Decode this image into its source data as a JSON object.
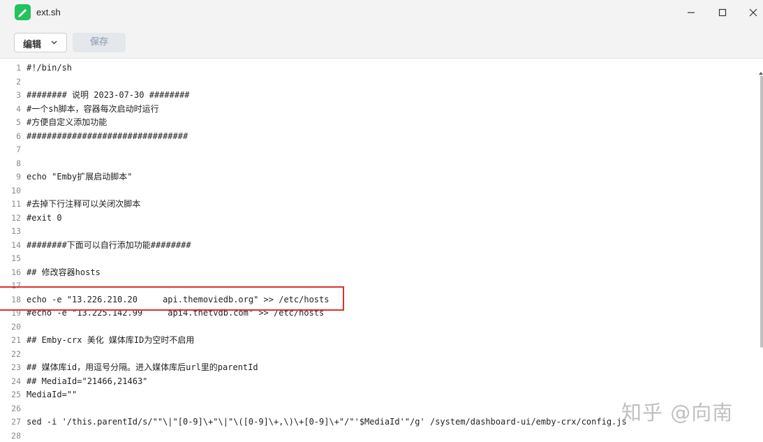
{
  "window": {
    "title": "ext.sh",
    "accent": "#22c35d"
  },
  "toolbar": {
    "edit_label": "编辑",
    "save_label": "保存"
  },
  "editor": {
    "lines": [
      {
        "n": "1",
        "text": "#!/bin/sh"
      },
      {
        "n": "2",
        "text": ""
      },
      {
        "n": "3",
        "text": "######## 说明 2023-07-30 ########"
      },
      {
        "n": "4",
        "text": "#一个sh脚本，容器每次启动时运行"
      },
      {
        "n": "5",
        "text": "#方便自定义添加功能"
      },
      {
        "n": "6",
        "text": "################################"
      },
      {
        "n": "7",
        "text": ""
      },
      {
        "n": "8",
        "text": ""
      },
      {
        "n": "9",
        "text": "echo \"Emby扩展启动脚本\""
      },
      {
        "n": "10",
        "text": ""
      },
      {
        "n": "11",
        "text": "#去掉下行注释可以关闭次脚本"
      },
      {
        "n": "12",
        "text": "#exit 0"
      },
      {
        "n": "13",
        "text": ""
      },
      {
        "n": "14",
        "text": "########下面可以自行添加功能########"
      },
      {
        "n": "15",
        "text": ""
      },
      {
        "n": "16",
        "text": "## 修改容器hosts"
      },
      {
        "n": "17",
        "text": ""
      },
      {
        "n": "18",
        "text": "echo -e \"13.226.210.20     api.themoviedb.org\" >> /etc/hosts"
      },
      {
        "n": "19",
        "text": "#echo -e \"13.225.142.99     api4.thetvdb.com\" >> /etc/hosts"
      },
      {
        "n": "20",
        "text": ""
      },
      {
        "n": "21",
        "text": "## Emby-crx 美化 媒体库ID为空时不启用"
      },
      {
        "n": "22",
        "text": ""
      },
      {
        "n": "23",
        "text": "## 媒体库id，用逗号分隔。进入媒体库后url里的parentId"
      },
      {
        "n": "24",
        "text": "## MediaId=\"21466,21463\""
      },
      {
        "n": "25",
        "text": "MediaId=\"\""
      },
      {
        "n": "26",
        "text": ""
      },
      {
        "n": "27",
        "text": "sed -i '/this.parentId/s/\"\"\\|\"[0-9]\\+\"\\|\"\\([0-9]\\+,\\)\\+[0-9]\\+\"/\"'$MediaId'\"/g' /system/dashboard-ui/emby-crx/config.js"
      },
      {
        "n": "28",
        "text": ""
      }
    ]
  },
  "watermark": "知乎 @向南"
}
